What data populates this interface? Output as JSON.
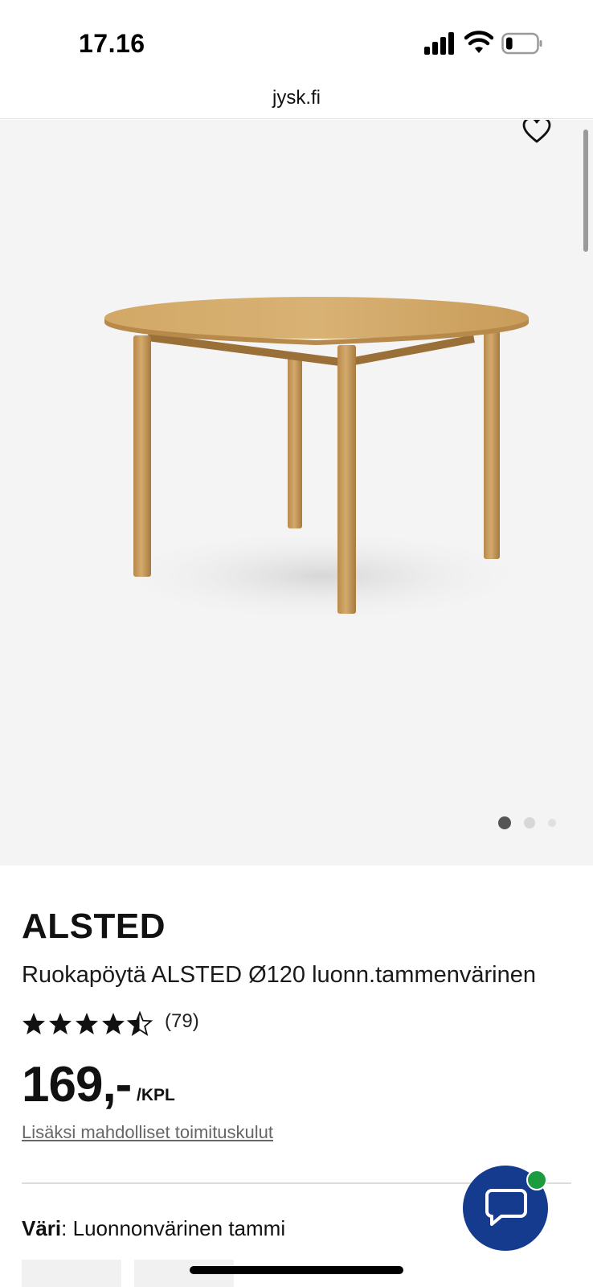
{
  "status_bar": {
    "time": "17.16",
    "battery_level": 0.2
  },
  "browser": {
    "url": "jysk.fi"
  },
  "gallery": {
    "image_alt": "Round oak dining table",
    "current_index": 1,
    "total_images": 3,
    "icons": {
      "favorite": "heart-icon"
    }
  },
  "product": {
    "brand": "ALSTED",
    "name": "Ruokapöytä ALSTED Ø120 luonn.tammenvärinen",
    "rating": 4.5,
    "rating_max": 5,
    "review_count": "(79)",
    "price": "169,-",
    "unit": "/KPL",
    "shipping_note": "Lisäksi mahdolliset toimituskulut",
    "color_label": "Väri",
    "color_value": ": Luonnonvärinen tammi"
  },
  "colors": {
    "chat_button": "#143b8e",
    "online_badge": "#1c9b3f",
    "gallery_bg": "#f4f4f4",
    "table_wood": "#c9a064"
  },
  "chat": {
    "icon": "chat-bubble-icon"
  }
}
